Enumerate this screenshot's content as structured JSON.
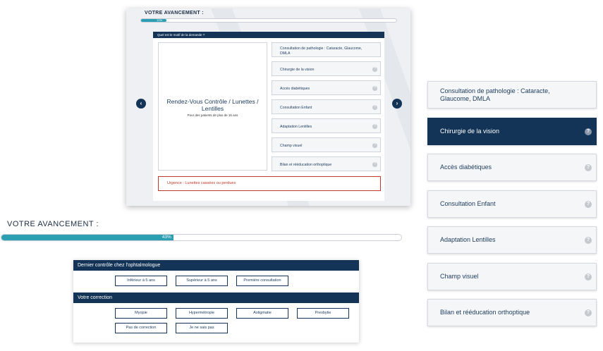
{
  "top_card": {
    "progress_title": "VOTRE AVANCEMENT :",
    "progress_value": 0.1,
    "progress_label": "10%",
    "question": "Quel est le motif de la demande ?",
    "main_choice_title": "Rendez-Vous Contrôle / Lunettes / Lentilles",
    "main_choice_sub": "Pour des patients de plus de 16 ans",
    "options": [
      {
        "label": "Consultation de pathologie : Cataracte, Glaucome, DMLA",
        "help": false
      },
      {
        "label": "Chirurgie de la vision",
        "help": true
      },
      {
        "label": "Accès diabétiques",
        "help": true
      },
      {
        "label": "Consultation Enfant",
        "help": true
      },
      {
        "label": "Adaptation Lentilles",
        "help": true
      },
      {
        "label": "Champ visuel",
        "help": true
      },
      {
        "label": "Bilan et rééducation orthoptique",
        "help": true
      }
    ],
    "urgence": "Urgence : Lunettes cassées ou perdues",
    "prev_icon": "chevron-left-icon",
    "next_icon": "chevron-right-icon"
  },
  "middle": {
    "progress_title": "VOTRE AVANCEMENT :",
    "progress_value": 0.43,
    "progress_label": "43%"
  },
  "form": {
    "section1_title": "Dernier contrôle chez l'ophtalmologue",
    "section1_options": [
      "Inférieur à 5 ans",
      "Supérieur à 5 ans",
      "Première consultation"
    ],
    "section2_title": "Votre correction",
    "section2_options_row1": [
      "Myopie",
      "Hypermétropie",
      "Astigmatie",
      "Presbytie"
    ],
    "section2_options_row2": [
      "Pas de correction",
      "Je ne sais pas"
    ]
  },
  "right_list": {
    "help_glyph": "?",
    "items": [
      {
        "label": "Consultation de pathologie : Cataracte, Glaucome, DMLA",
        "active": false,
        "help": false
      },
      {
        "label": "Chirurgie de la vision",
        "active": true,
        "help": true
      },
      {
        "label": "Accès diabétiques",
        "active": false,
        "help": true
      },
      {
        "label": "Consultation Enfant",
        "active": false,
        "help": true
      },
      {
        "label": "Adaptation Lentilles",
        "active": false,
        "help": true
      },
      {
        "label": "Champ visuel",
        "active": false,
        "help": true
      },
      {
        "label": "Bilan et rééducation orthoptique",
        "active": false,
        "help": true
      }
    ]
  },
  "colors": {
    "navy": "#133456",
    "teal": "#2d9fb3",
    "alert": "#c0392b"
  }
}
